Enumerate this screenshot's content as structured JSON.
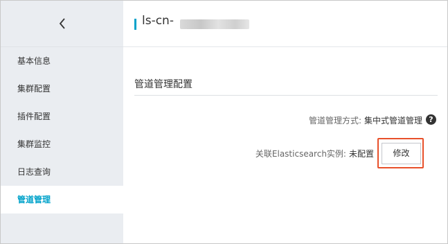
{
  "header": {
    "instance_id_prefix": "ls-cn-",
    "back_icon": "chevron-left-icon"
  },
  "sidebar": {
    "items": [
      {
        "label": "基本信息",
        "active": false
      },
      {
        "label": "集群配置",
        "active": false
      },
      {
        "label": "插件配置",
        "active": false
      },
      {
        "label": "集群监控",
        "active": false
      },
      {
        "label": "日志查询",
        "active": false
      },
      {
        "label": "管道管理",
        "active": true
      }
    ]
  },
  "main": {
    "section_title": "管道管理配置",
    "pipeline_mode": {
      "label": "管道管理方式:",
      "value": "集中式管道管理",
      "help_icon": "question-circle-icon"
    },
    "es_instance": {
      "label": "关联Elasticsearch实例:",
      "value": "未配置",
      "edit_label": "修改"
    }
  },
  "colors": {
    "accent": "#00a2ca",
    "highlight": "#e8502a",
    "sidebar_bg": "#eaedf1"
  }
}
